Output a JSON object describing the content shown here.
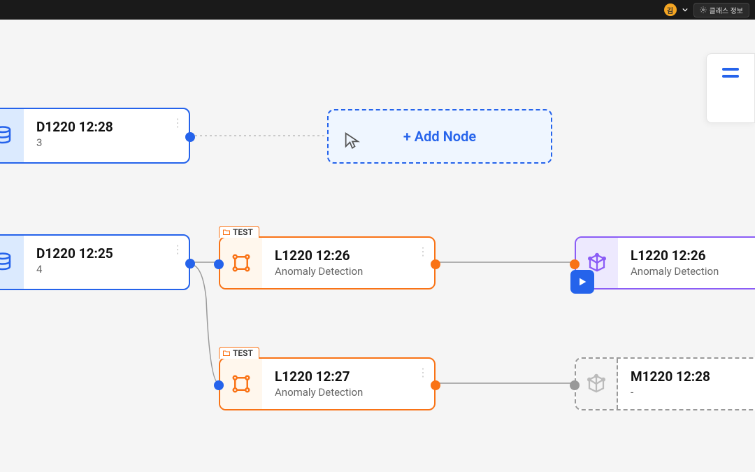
{
  "topbar": {
    "avatar_letter": "김",
    "button_label": "클래스 정보"
  },
  "nodes": {
    "d1": {
      "title": "D1220 12:28",
      "subtitle": "3"
    },
    "d2": {
      "title": "D1220 12:25",
      "subtitle": "4"
    },
    "l1": {
      "title": "L1220 12:26",
      "subtitle": "Anomaly Detection",
      "tag": "TEST"
    },
    "l2": {
      "title": "L1220 12:27",
      "subtitle": "Anomaly Detection",
      "tag": "TEST"
    },
    "p1": {
      "title": "L1220 12:26",
      "subtitle": "Anomaly Detection"
    },
    "m1": {
      "title": "M1220 12:28",
      "subtitle": "-"
    }
  },
  "add_node": {
    "label": "+ Add Node"
  }
}
